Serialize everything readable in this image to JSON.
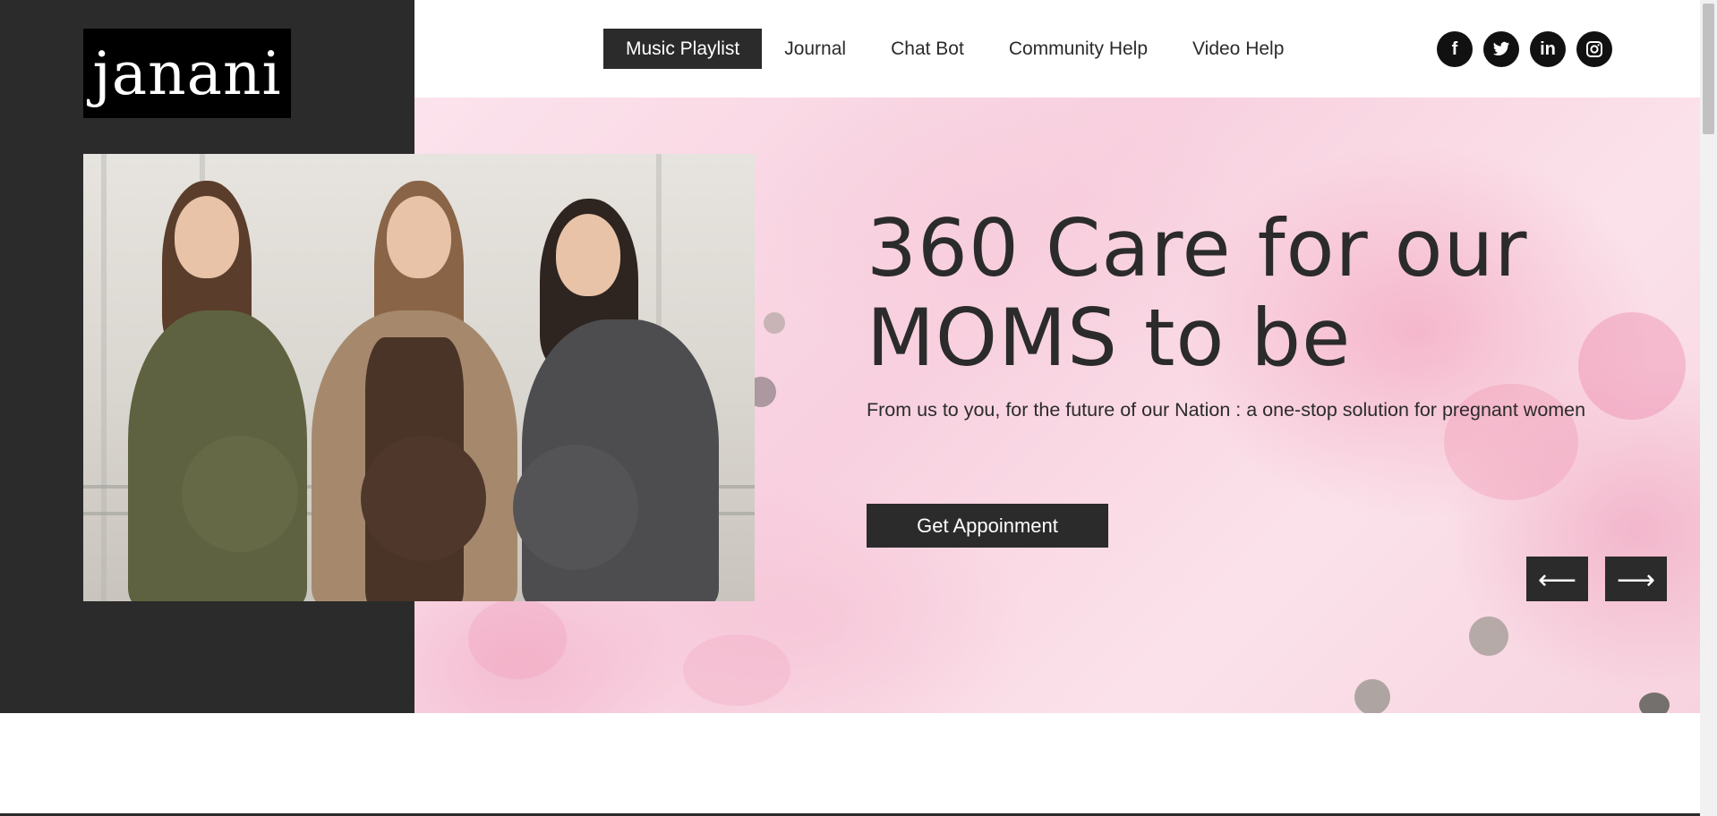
{
  "brand": {
    "logo_text": "janani"
  },
  "nav": {
    "items": [
      {
        "label": "Music Playlist",
        "active": true
      },
      {
        "label": "Journal",
        "active": false
      },
      {
        "label": "Chat Bot",
        "active": false
      },
      {
        "label": "Community Help",
        "active": false
      },
      {
        "label": "Video Help",
        "active": false
      }
    ]
  },
  "socials": [
    {
      "icon": "facebook-icon",
      "glyph": "f"
    },
    {
      "icon": "twitter-icon",
      "glyph": "🐦"
    },
    {
      "icon": "linkedin-icon",
      "glyph": "in"
    },
    {
      "icon": "instagram-icon",
      "glyph": "◘"
    }
  ],
  "hero": {
    "headline": "360 Care for our MOMS to be",
    "subtext": "From us to you, for the future of our Nation : a one-stop solution for pregnant women",
    "cta_label": "Get Appoinment",
    "prev_arrow": "⟵",
    "next_arrow": "⟶"
  },
  "colors": {
    "dark": "#2b2b2b",
    "pink_bg": "#f8d0df",
    "white": "#ffffff"
  }
}
